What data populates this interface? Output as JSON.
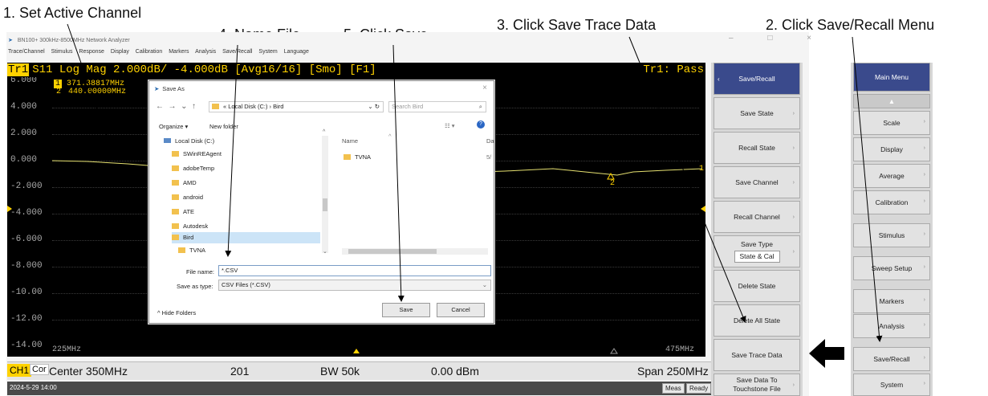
{
  "annotations": {
    "step1": "1. Set Active Channel",
    "step2": "2. Click Save/Recall Menu",
    "step3": "3. Click Save Trace Data",
    "step4": "4. Name File",
    "step5": "5. Click Save"
  },
  "app": {
    "title": "BN100+ 300kHz-8500MHz Network Analyzer",
    "window_controls": "–  □  ×",
    "menu": [
      "Trace/Channel",
      "Stimulus",
      "Response",
      "Display",
      "Calibration",
      "Markers",
      "Analysis",
      "Save/Recall",
      "System",
      "Language"
    ]
  },
  "trace": {
    "tr_label": "Tr1",
    "header": "S11 Log Mag 2.000dB/ -4.000dB [Avg16/16] [Smo]  [F1]",
    "pass_text": "Tr1: Pass",
    "y_ticks": [
      "6.000",
      "4.000",
      "2.000",
      "0.000",
      "-2.000",
      "-4.000",
      "-6.000",
      "-8.000",
      "-10.00",
      "-12.00",
      "-14.00"
    ],
    "marker1_num": "1",
    "marker1_val": "371.38817MHz",
    "marker2_num": "2",
    "marker2_val": "440.00000MHz",
    "x_start": "225MHz",
    "x_stop": "475MHz",
    "marker_label_1": "1",
    "marker_label_2": "2",
    "trace_color": "#e5e070"
  },
  "status": {
    "ch": "CH1",
    "cor": "Cor",
    "center": "Center 350MHz",
    "points": "201",
    "bw": "BW 50k",
    "power": "0.00 dBm",
    "span": "Span 250MHz"
  },
  "bottombar": {
    "datetime": "2024-5-29 14:00",
    "meas": "Meas",
    "ready": "Ready"
  },
  "softkeys": {
    "header": "Save/Recall",
    "items": [
      "Save State",
      "Recall State",
      "Save Channel",
      "Recall Channel",
      "Save Type",
      "Delete State",
      "Delete All State",
      "Save Trace Data",
      "Save Data To Touchstone File"
    ],
    "save_type_value": "State & Cal"
  },
  "main_menu": {
    "header": "Main Menu",
    "items": [
      "Scale",
      "Display",
      "Average",
      "Calibration",
      "Stimulus",
      "Sweep Setup",
      "Markers",
      "Analysis",
      "Save/Recall",
      "System"
    ]
  },
  "dialog": {
    "title": "Save As",
    "path_prefix": "«",
    "path": "Local Disk (C:)  ›  Bird",
    "search_placeholder": "Search Bird",
    "organize": "Organize ▾",
    "new_folder": "New folder",
    "tree": [
      "Local Disk (C:)",
      "SWinREAgent",
      "adobeTemp",
      "AMD",
      "android",
      "ATE",
      "Autodesk",
      "Bird",
      "TVNA"
    ],
    "col_name": "Name",
    "col_date": "Da",
    "files": [
      "TVNA"
    ],
    "file_date": "5/",
    "file_name_label": "File name:",
    "file_name_value": "*.CSV",
    "save_type_label": "Save as type:",
    "save_type_value": "CSV Files (*.CSV)",
    "hide_folders": "Hide Folders",
    "save_btn": "Save",
    "cancel_btn": "Cancel"
  }
}
